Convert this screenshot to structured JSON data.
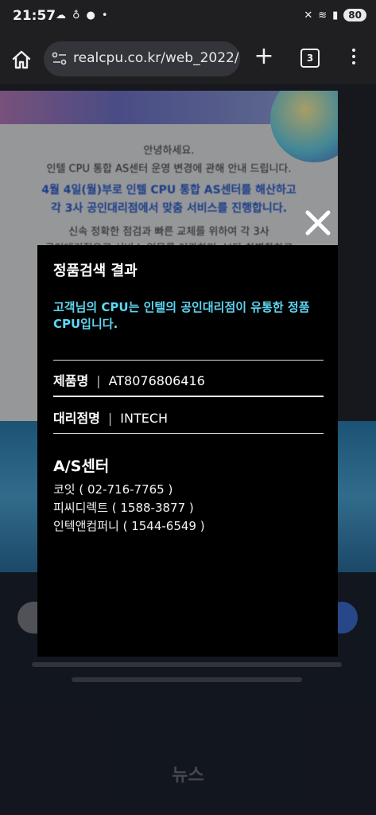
{
  "status_bar": {
    "time": "21:57",
    "battery": "80"
  },
  "browser": {
    "url": "realcpu.co.kr/web_2022/",
    "tab_count": "3"
  },
  "background_page": {
    "greeting": "안녕하세요.",
    "intro": "인텔 CPU 통합 AS센터 운영 변경에 관해 안내 드립니다.",
    "highlight_1": "4월 4일(월)부로 인텔 CPU 통합 AS센터를 해산하고",
    "highlight_2": "각 3사 공인대리점에서 맞춤 서비스를 진행합니다.",
    "body_1": "신속 정확한 점검과 빠른 교체를 위하여 각 3사",
    "body_2": "공인대리점으로 서비스 업무를 이관하며, 보다 차별화하고",
    "news": "뉴스"
  },
  "modal": {
    "title": "정품검색 결과",
    "message": "고객님의 CPU는 인텔의 공인대리점이 유통한 정품 CPU입니다.",
    "product_label": "제품명",
    "product_value": "AT8076806416",
    "dealer_label": "대리점명",
    "dealer_value": "INTECH",
    "separator": "|",
    "as_title": "A/S센터",
    "as_centers": [
      "코잇 ( 02-716-7765 )",
      "피씨디렉트 ( 1588-3877 )",
      "인텍앤컴퍼니 ( 1544-6549 )"
    ]
  }
}
